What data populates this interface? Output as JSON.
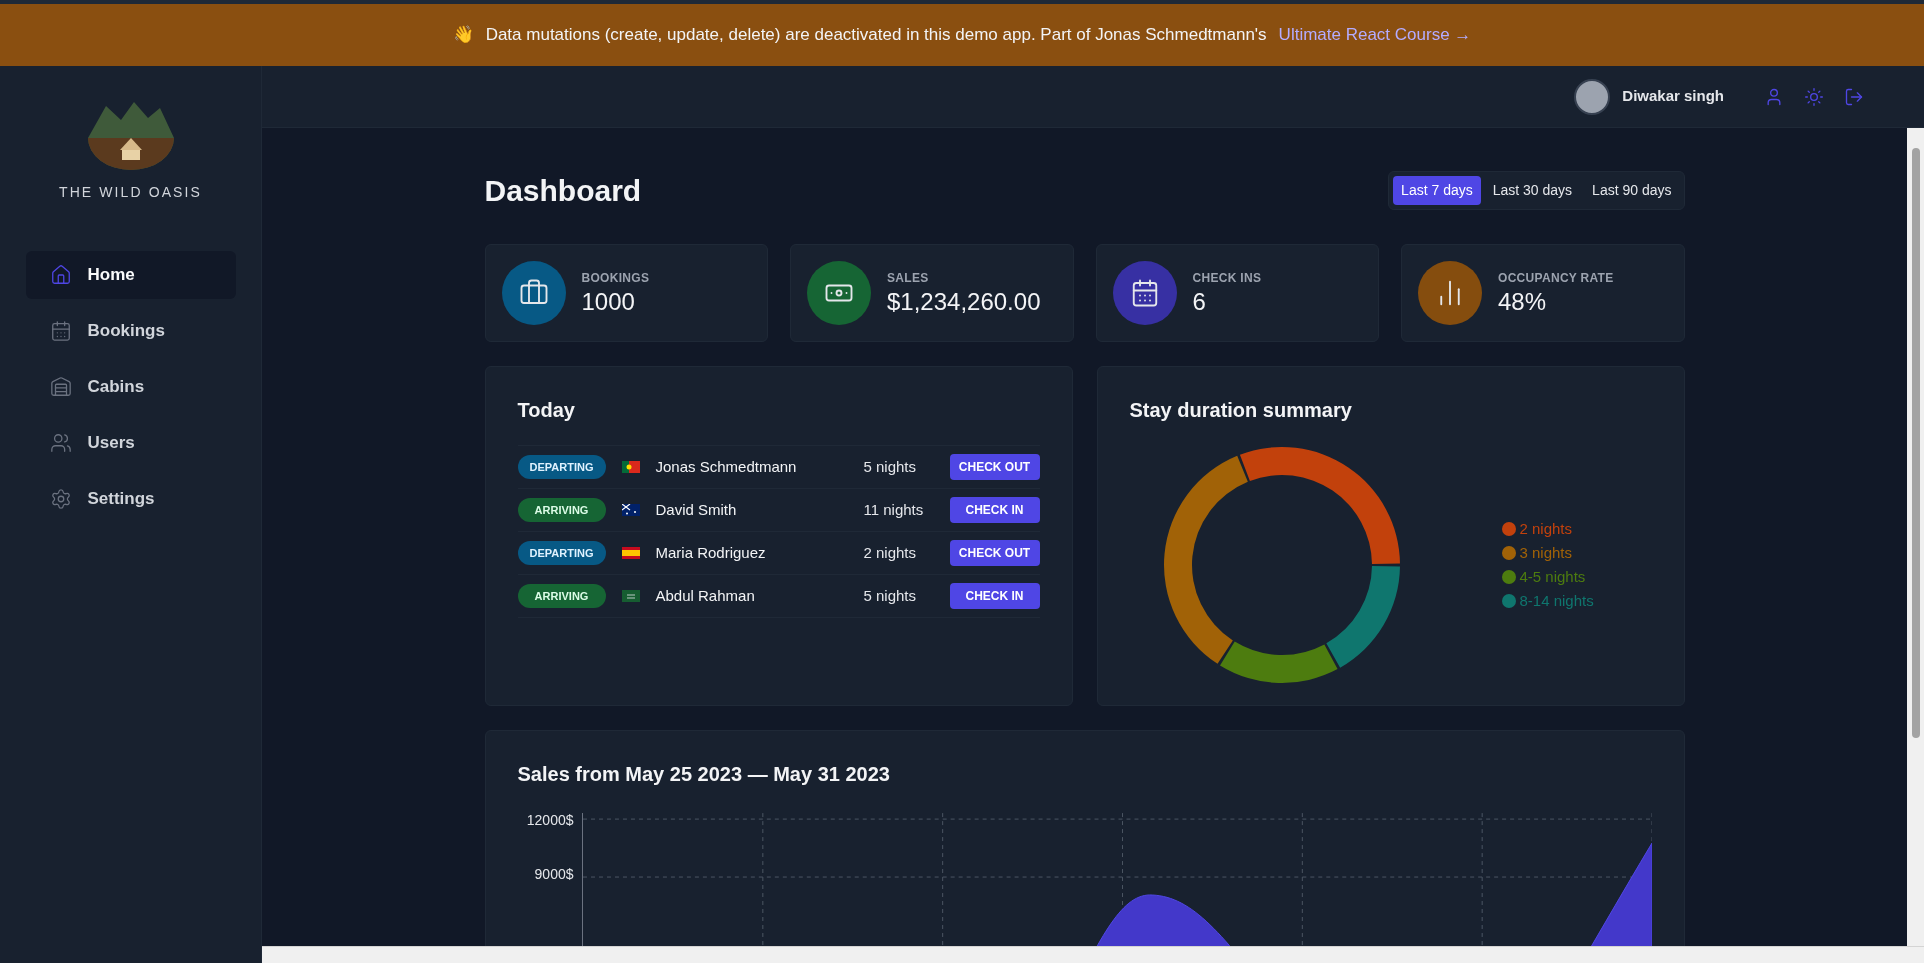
{
  "banner": {
    "emoji": "👋",
    "text": "Data mutations (create, update, delete) are deactivated in this demo app. Part of Jonas Schmedtmann's",
    "link": "Ultimate React Course →"
  },
  "sidebar": {
    "brand": "THE WILD OASIS",
    "items": [
      {
        "label": "Home",
        "selected": true
      },
      {
        "label": "Bookings",
        "selected": false
      },
      {
        "label": "Cabins",
        "selected": false
      },
      {
        "label": "Users",
        "selected": false
      },
      {
        "label": "Settings",
        "selected": false
      }
    ]
  },
  "header": {
    "user_name": "Diwakar singh"
  },
  "page_title": "Dashboard",
  "filters": [
    {
      "label": "Last 7 days",
      "selected": true
    },
    {
      "label": "Last 30 days",
      "selected": false
    },
    {
      "label": "Last 90 days",
      "selected": false
    }
  ],
  "stats": [
    {
      "color": "#075985",
      "label": "BOOKINGS",
      "value": "1000"
    },
    {
      "color": "#166534",
      "label": "SALES",
      "value": "$1,234,260.00"
    },
    {
      "color": "#3730a3",
      "label": "CHECK INS",
      "value": "6"
    },
    {
      "color": "#854d0e",
      "label": "OCCUPANCY RATE",
      "value": "48%"
    }
  ],
  "today": {
    "title": "Today",
    "rows": [
      {
        "kind": "departing",
        "status": "DEPARTING",
        "guest": "Jonas Schmedtmann",
        "nights": "5 nights",
        "action": "CHECK OUT"
      },
      {
        "kind": "arriving",
        "status": "ARRIVING",
        "guest": "David Smith",
        "nights": "11 nights",
        "action": "CHECK IN"
      },
      {
        "kind": "departing",
        "status": "DEPARTING",
        "guest": "Maria Rodriguez",
        "nights": "2 nights",
        "action": "CHECK OUT"
      },
      {
        "kind": "arriving",
        "status": "ARRIVING",
        "guest": "Abdul Rahman",
        "nights": "5 nights",
        "action": "CHECK IN"
      }
    ]
  },
  "stay_summary": {
    "title": "Stay duration summary",
    "chart_data": {
      "type": "donut",
      "categories": [
        "2 nights",
        "3 nights",
        "4-5 nights",
        "8-14 nights"
      ],
      "colors": [
        "#c2410c",
        "#a16207",
        "#4d7c0f",
        "#0f766e"
      ],
      "values": [
        0.31,
        0.35,
        0.17,
        0.17
      ]
    }
  },
  "sales": {
    "title": "Sales from May 25 2023 — May 31 2023",
    "y_tick_labels": [
      "12000$",
      "9000$"
    ]
  }
}
